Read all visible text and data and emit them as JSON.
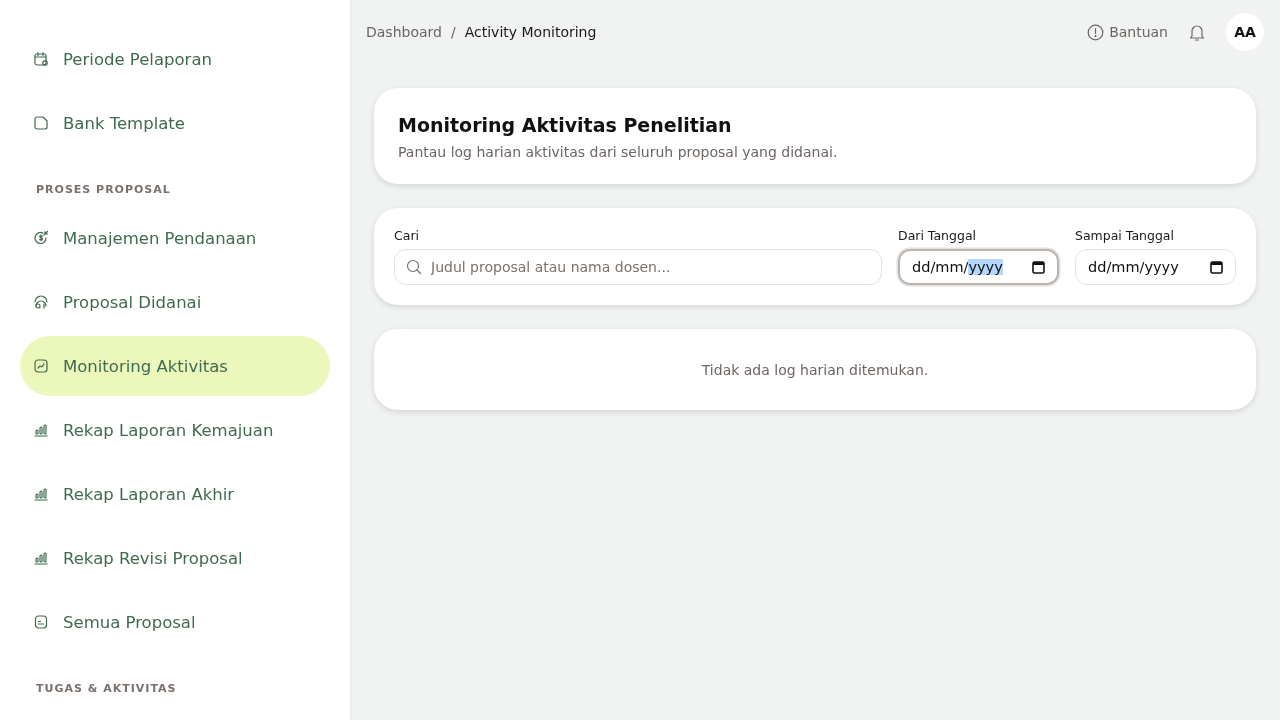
{
  "sidebar": {
    "groups": [
      {
        "items": [
          {
            "label": "Periode Pelaporan",
            "kind": "calendar",
            "selected": false
          },
          {
            "label": "Bank Template",
            "kind": "note",
            "selected": false
          }
        ]
      },
      {
        "label": "PROSES PROPOSAL",
        "items": [
          {
            "label": "Manajemen Pendanaan",
            "kind": "dollar",
            "selected": false
          },
          {
            "label": "Proposal Didanai",
            "kind": "fund",
            "selected": false
          },
          {
            "label": "Monitoring Aktivitas",
            "kind": "chart",
            "selected": true
          },
          {
            "label": "Rekap Laporan Kemajuan",
            "kind": "bars",
            "selected": false
          },
          {
            "label": "Rekap Laporan Akhir",
            "kind": "bars",
            "selected": false
          },
          {
            "label": "Rekap Revisi Proposal",
            "kind": "bars",
            "selected": false
          },
          {
            "label": "Semua Proposal",
            "kind": "file",
            "selected": false
          }
        ]
      },
      {
        "label": "TUGAS & AKTIVITAS"
      }
    ]
  },
  "header": {
    "breadcrumb": [
      {
        "label": "Dashboard",
        "current": false
      },
      {
        "label": "Activity Monitoring",
        "current": true
      }
    ],
    "separator": "/",
    "help": "Bantuan",
    "avatar": "AA"
  },
  "intro": {
    "title": "Monitoring Aktivitas Penelitian",
    "subtitle": "Pantau log harian aktivitas dari seluruh proposal yang didanai."
  },
  "filters": {
    "search": {
      "label": "Cari",
      "placeholder": "Judul proposal atau nama dosen..."
    },
    "dates": [
      {
        "label": "Dari Tanggal",
        "focused": true,
        "parts": [
          {
            "text": "dd/mm/",
            "selected": false
          },
          {
            "text": "yyyy",
            "selected": true
          }
        ]
      },
      {
        "label": "Sampai Tanggal",
        "focused": false,
        "parts": [
          {
            "text": "dd/mm/yyyy",
            "selected": false
          }
        ]
      }
    ]
  },
  "empty_message": "Tidak ada log harian ditemukan."
}
